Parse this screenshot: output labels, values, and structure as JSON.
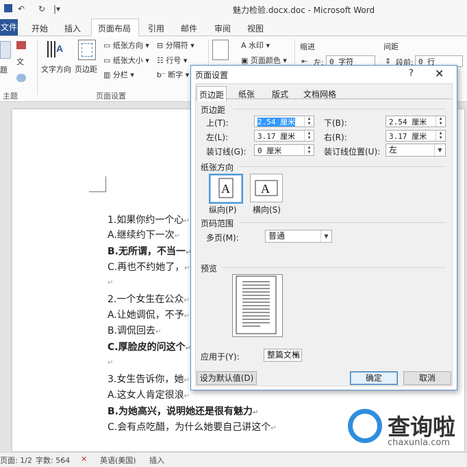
{
  "window": {
    "title": "魅力检验.docx.doc - Microsoft Word"
  },
  "quick_access": {
    "save_icon": "save-icon",
    "undo": "↶",
    "redo": "↻"
  },
  "tabs": {
    "file": "文件",
    "home": "开始",
    "insert": "插入",
    "layout": "页面布局",
    "references": "引用",
    "mailings": "邮件",
    "review": "审阅",
    "view": "视图"
  },
  "ribbon": {
    "theme_group": "主题",
    "theme_btn": "题",
    "text_dir": "文字方向",
    "margins": "页边距",
    "size_orient": "纸张方向",
    "size": "纸张大小",
    "columns": "分栏",
    "breaks": "分隔符",
    "line_numbers": "行号",
    "hyphen": "断字",
    "page_setup_group": "页面设置",
    "watermark": "水印",
    "page_color": "页面颜色",
    "indent": "缩进",
    "indent_left_label": "左:",
    "indent_left_value": "0 字符",
    "spacing": "间距",
    "spacing_before_label": "段前:",
    "spacing_before_value": "0 行"
  },
  "document": {
    "lines": [
      {
        "text": "1.如果你约一个心",
        "bold": false
      },
      {
        "text": "A.继续约下一次",
        "bold": false
      },
      {
        "text": "B.无所谓，不当一",
        "bold": true
      },
      {
        "text": "C.再也不约她了，",
        "bold": false
      },
      {
        "text": "",
        "bold": false
      },
      {
        "text": "2.一个女生在公众",
        "bold": false
      },
      {
        "text": "A.让她调侃，不予",
        "bold": false
      },
      {
        "text": "B.调侃回去",
        "bold": false
      },
      {
        "text": "C.厚脸皮的问这个",
        "bold": true
      },
      {
        "text": "",
        "bold": false
      },
      {
        "text": "3.女生告诉你，她",
        "bold": false
      },
      {
        "text": "A.这女人肯定很浪",
        "bold": false
      },
      {
        "text": "B.为她高兴，说明她还是很有魅力",
        "bold": true
      },
      {
        "text": "C.会有点吃醋，为什么她要自己讲这个",
        "bold": false
      }
    ],
    "return_mark": "↵"
  },
  "status": {
    "page": "页面: 1/2",
    "words": "字数: 564",
    "lang": "英语(美国)",
    "mode": "插入"
  },
  "dialog": {
    "title": "页面设置",
    "help": "?",
    "close": "✕",
    "tabs": [
      "页边距",
      "纸张",
      "版式",
      "文档网格"
    ],
    "margins_section": "页边距",
    "top_label": "上(T):",
    "top_value": "2.54 厘米",
    "bottom_label": "下(B):",
    "bottom_value": "2.54 厘米",
    "left_label": "左(L):",
    "left_value": "3.17 厘米",
    "right_label": "右(R):",
    "right_value": "3.17 厘米",
    "gutter_label": "装订线(G):",
    "gutter_value": "0 厘米",
    "gutter_pos_label": "装订线位置(U):",
    "gutter_pos_value": "左",
    "orientation_section": "纸张方向",
    "portrait": "纵向(P)",
    "landscape": "横向(S)",
    "orientation_glyph": "A",
    "pages_section": "页码范围",
    "multi_label": "多页(M):",
    "multi_value": "普通",
    "preview_section": "预览",
    "apply_label": "应用于(Y):",
    "apply_value": "整篇文档",
    "default_btn": "设为默认值(D)",
    "ok_btn": "确定",
    "cancel_btn": "取消"
  },
  "watermark": {
    "name": "查询啦",
    "url": "chaxunla.com"
  }
}
